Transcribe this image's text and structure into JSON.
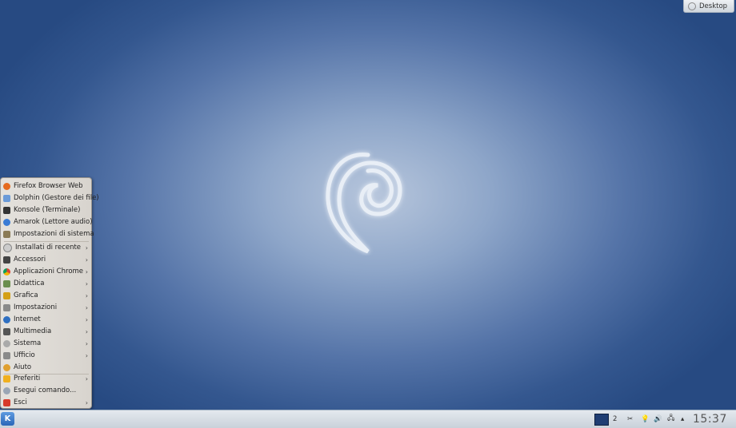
{
  "desktop_button": {
    "label": "Desktop",
    "icon": "desktop-icon"
  },
  "menu": {
    "favorites": [
      {
        "label": "Firefox Browser Web",
        "icon": "firefox-icon",
        "color": "#e66a1f"
      },
      {
        "label": "Dolphin (Gestore dei file)",
        "icon": "folder-icon",
        "color": "#6a9ad8"
      },
      {
        "label": "Konsole (Terminale)",
        "icon": "terminal-icon",
        "color": "#333333"
      },
      {
        "label": "Amarok (Lettore audio)",
        "icon": "amarok-icon",
        "color": "#3a7bd5"
      },
      {
        "label": "Impostazioni di sistema",
        "icon": "settings-icon",
        "color": "#8a7a55"
      }
    ],
    "categories": [
      {
        "label": "Installati di recente",
        "icon": "clock-icon",
        "color": "#cccccc"
      },
      {
        "label": "Accessori",
        "icon": "accessories-icon",
        "color": "#444444"
      },
      {
        "label": "Applicazioni Chrome",
        "icon": "chrome-icon",
        "color": "#4caf50"
      },
      {
        "label": "Didattica",
        "icon": "education-icon",
        "color": "#6b8e4e"
      },
      {
        "label": "Grafica",
        "icon": "graphics-icon",
        "color": "#d4a017"
      },
      {
        "label": "Impostazioni",
        "icon": "tools-icon",
        "color": "#8a8a8a"
      },
      {
        "label": "Internet",
        "icon": "globe-icon",
        "color": "#2f6fc1"
      },
      {
        "label": "Multimedia",
        "icon": "multimedia-icon",
        "color": "#555555"
      },
      {
        "label": "Sistema",
        "icon": "system-icon",
        "color": "#aaaaaa"
      },
      {
        "label": "Ufficio",
        "icon": "office-icon",
        "color": "#8a8a8a"
      }
    ],
    "help": {
      "label": "Aiuto",
      "icon": "help-icon",
      "color": "#e0a030"
    },
    "bottom": [
      {
        "label": "Preferiti",
        "icon": "star-icon",
        "color": "#f0b020",
        "submenu": true
      },
      {
        "label": "Esegui comando...",
        "icon": "run-icon",
        "color": "#9aa6b5",
        "submenu": false
      },
      {
        "label": "Esci",
        "icon": "power-icon",
        "color": "#d83a2a",
        "submenu": true
      }
    ]
  },
  "taskbar": {
    "start_icon": "kde-start-icon",
    "tray_num": "2",
    "clock": "15:37"
  }
}
